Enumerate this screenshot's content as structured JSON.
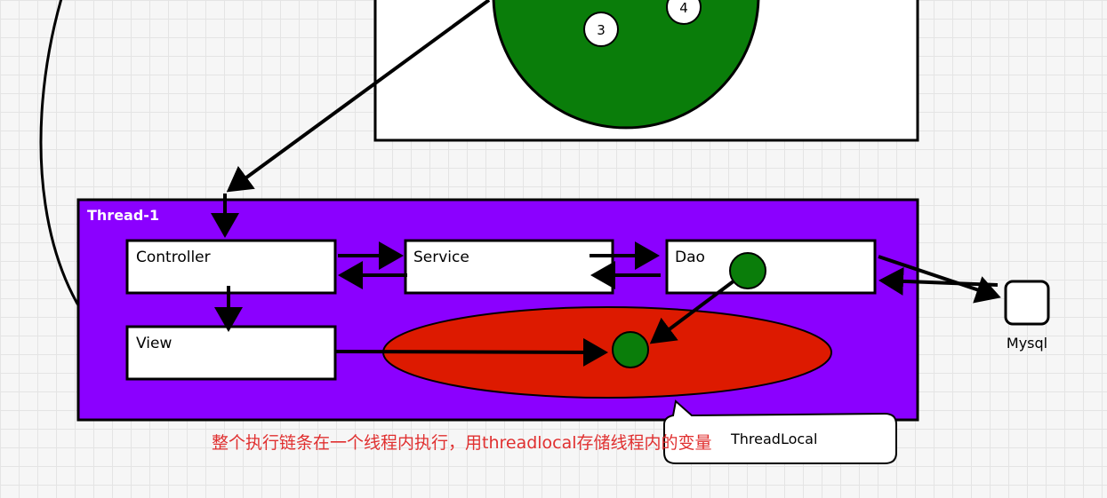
{
  "thread_label": "Thread-1",
  "boxes": {
    "controller": "Controller",
    "service": "Service",
    "dao": "Dao",
    "view": "View"
  },
  "pool_items": [
    "3",
    "4"
  ],
  "mysql_label": "Mysql",
  "threadlocal_label": "ThreadLocal",
  "caption": "整个执行链条在一个线程内执行，用threadlocal存储线程内的变量",
  "colors": {
    "thread_bg": "#8b00ff",
    "ellipse": "#dd1a00",
    "circle_green": "#0a7d0a",
    "caption": "#e03030"
  }
}
